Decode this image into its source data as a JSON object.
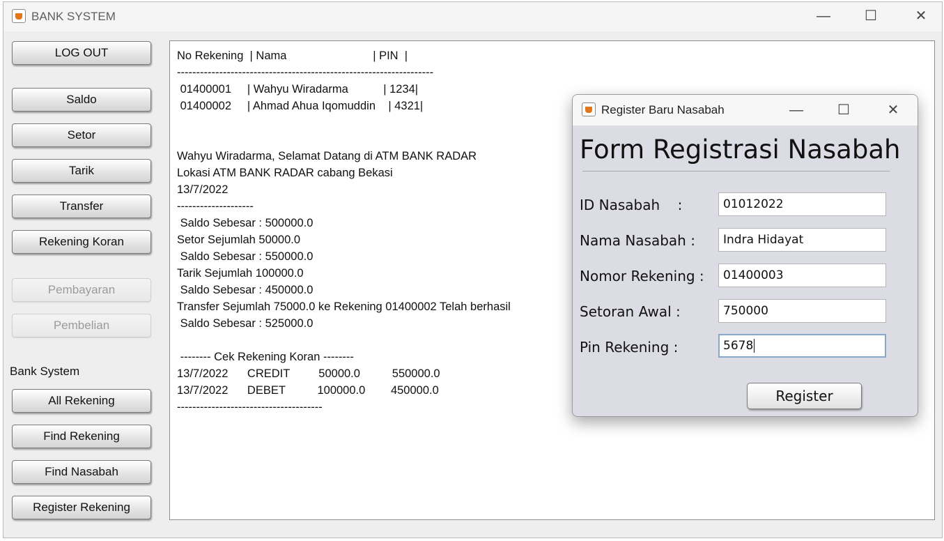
{
  "main_window": {
    "title": "BANK SYSTEM",
    "controls": {
      "minimize": "—",
      "maximize": "☐",
      "close": "✕"
    }
  },
  "sidebar": {
    "logout": "LOG OUT",
    "transaction_buttons": [
      {
        "label": "Saldo",
        "enabled": true
      },
      {
        "label": "Setor",
        "enabled": true
      },
      {
        "label": "Tarik",
        "enabled": true
      },
      {
        "label": "Transfer",
        "enabled": true
      },
      {
        "label": "Rekening Koran",
        "enabled": true
      },
      {
        "label": "Pembayaran",
        "enabled": false
      },
      {
        "label": "Pembelian",
        "enabled": false
      }
    ],
    "section_label": "Bank System",
    "system_buttons": [
      {
        "label": "All Rekening"
      },
      {
        "label": "Find Rekening"
      },
      {
        "label": "Find Nasabah"
      },
      {
        "label": "Register Rekening"
      }
    ]
  },
  "output": {
    "lines": [
      "No Rekening  | Nama                           | PIN  |",
      "-------------------------------------------------------------------",
      " 01400001     | Wahyu Wiradarma           | 1234|",
      " 01400002     | Ahmad Ahua Iqomuddin    | 4321|",
      "",
      "",
      "Wahyu Wiradarma, Selamat Datang di ATM BANK RADAR",
      "Lokasi ATM BANK RADAR cabang Bekasi",
      "13/7/2022",
      "--------------------",
      " Saldo Sebesar : 500000.0",
      "Setor Sejumlah 50000.0",
      " Saldo Sebesar : 550000.0",
      "Tarik Sejumlah 100000.0",
      " Saldo Sebesar : 450000.0",
      "Transfer Sejumlah 75000.0 ke Rekening 01400002 Telah berhasil",
      " Saldo Sebesar : 525000.0",
      "",
      " -------- Cek Rekening Koran --------",
      "13/7/2022      CREDIT         50000.0          550000.0",
      "13/7/2022      DEBET          100000.0        450000.0",
      "--------------------------------------"
    ]
  },
  "dialog": {
    "title": "Register Baru Nasabah",
    "controls": {
      "minimize": "—",
      "maximize": "☐",
      "close": "✕"
    },
    "heading": "Form Registrasi Nasabah",
    "fields": [
      {
        "label": "ID Nasabah    :",
        "value": "01012022"
      },
      {
        "label": "Nama Nasabah :",
        "value": "Indra Hidayat"
      },
      {
        "label": "Nomor Rekening :",
        "value": "01400003"
      },
      {
        "label": "Setoran Awal :",
        "value": "750000"
      },
      {
        "label": "Pin Rekening :",
        "value": "5678"
      }
    ],
    "register_button": "Register"
  }
}
